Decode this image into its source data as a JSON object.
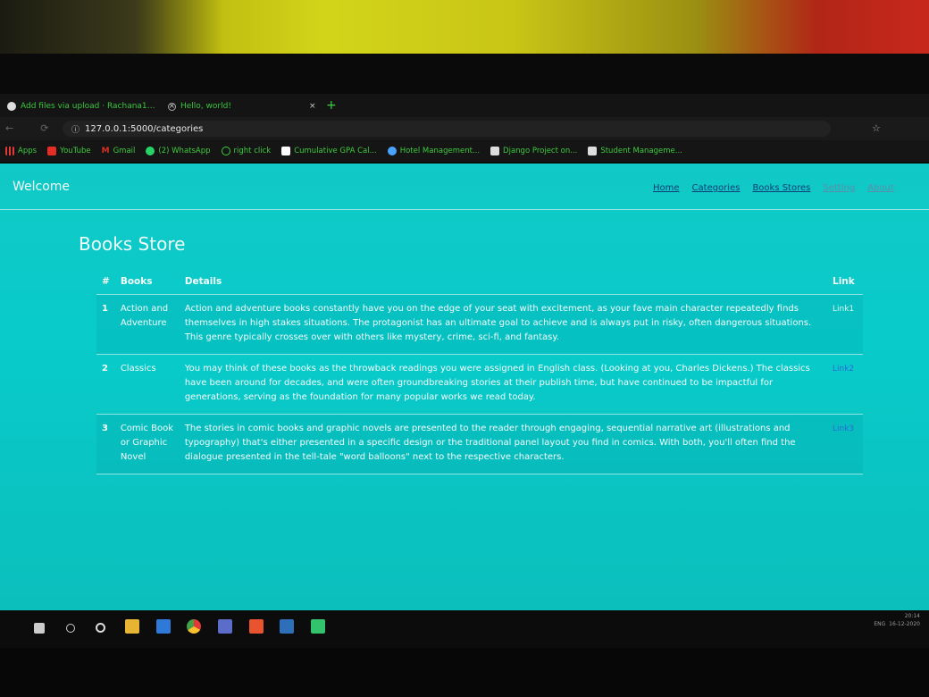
{
  "browser": {
    "tabs": [
      {
        "label": "Add files via upload · Rachana1…",
        "close": "×"
      },
      {
        "label": "Hello, world!",
        "close": "×"
      }
    ],
    "new_tab": "+",
    "url": "127.0.0.1:5000/categories",
    "bookmarks": [
      {
        "label": "Apps",
        "icon": "apps-icon",
        "color": "#e53935"
      },
      {
        "label": "YouTube",
        "icon": "youtube-icon",
        "color": "#e52d27"
      },
      {
        "label": "Gmail",
        "icon": "gmail-icon",
        "color": "#d93025"
      },
      {
        "label": "(2) WhatsApp",
        "icon": "whatsapp-icon",
        "color": "#25d366"
      },
      {
        "label": "right click",
        "icon": "globe-icon",
        "color": "#3ecb3e"
      },
      {
        "label": "Cumulative GPA Cal...",
        "icon": "aplus-icon",
        "color": "#ffffff"
      },
      {
        "label": "Hotel Management...",
        "icon": "hotel-icon",
        "color": "#4aa3ff"
      },
      {
        "label": "Django Project on...",
        "icon": "django-icon",
        "color": "#dddddd"
      },
      {
        "label": "Student Manageme...",
        "icon": "student-icon",
        "color": "#dddddd"
      }
    ]
  },
  "navbar": {
    "brand": "Welcome",
    "links": [
      "Home",
      "Categories",
      "Books Stores",
      "Setting",
      "About"
    ]
  },
  "main": {
    "title": "Books Store",
    "columns": [
      "#",
      "Books",
      "Details",
      "Link"
    ],
    "rows": [
      {
        "num": "1",
        "book": "Action and Adventure",
        "details": "Action and adventure books constantly have you on the edge of your seat with excitement, as your fave main character repeatedly finds themselves in high stakes situations. The protagonist has an ultimate goal to achieve and is always put in risky, often dangerous situations. This genre typically crosses over with others like mystery, crime, sci-fi, and fantasy.",
        "link": "Link1"
      },
      {
        "num": "2",
        "book": "Classics",
        "details": "You may think of these books as the throwback readings you were assigned in English class. (Looking at you, Charles Dickens.) The classics have been around for decades, and were often groundbreaking stories at their publish time, but have continued to be impactful for generations, serving as the foundation for many popular works we read today.",
        "link": "Link2"
      },
      {
        "num": "3",
        "book": "Comic Book or Graphic Novel",
        "details": "The stories in comic books and graphic novels are presented to the reader through engaging, sequential narrative art (illustrations and typography) that's either presented in a specific design or the traditional panel layout you find in comics. With both, you'll often find the dialogue presented in the tell-tale \"word balloons\" next to the respective characters.",
        "link": "Link3"
      }
    ]
  },
  "taskbar": {
    "lang": "ENG",
    "time": "20:14",
    "date": "16-12-2020"
  }
}
